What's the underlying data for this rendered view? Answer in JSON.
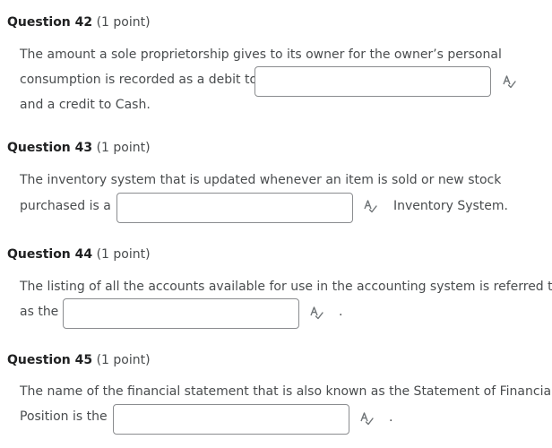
{
  "questions": [
    {
      "title": "Question 42",
      "points": "(1 point)",
      "line1": "The amount a sole proprietorship gives to its owner for the owner’s personal",
      "line2": "consumption is recorded as a debit to",
      "answer": "",
      "after": "",
      "line3": "and a credit to Cash."
    },
    {
      "title": "Question 43",
      "points": "(1 point)",
      "line1": "The inventory system that is updated whenever an item is sold or new stock",
      "line2": "purchased is a",
      "answer": "",
      "after": "Inventory System."
    },
    {
      "title": "Question 44",
      "points": "(1 point)",
      "line1": "The listing of all the accounts available for use in the accounting system is referred to",
      "line2": "as the",
      "answer": "",
      "after": "."
    },
    {
      "title": "Question 45",
      "points": "(1 point)",
      "line1": "The name of the financial statement that is also known as the Statement of Financial",
      "line2": "Position is the",
      "answer": "",
      "after": "."
    }
  ],
  "icons": {
    "spellcheck": "spellcheck-icon"
  },
  "colors": {
    "text": "#494c4e",
    "heading": "#202122",
    "input_border": "#8a8c8f",
    "icon": "#6e7376"
  }
}
